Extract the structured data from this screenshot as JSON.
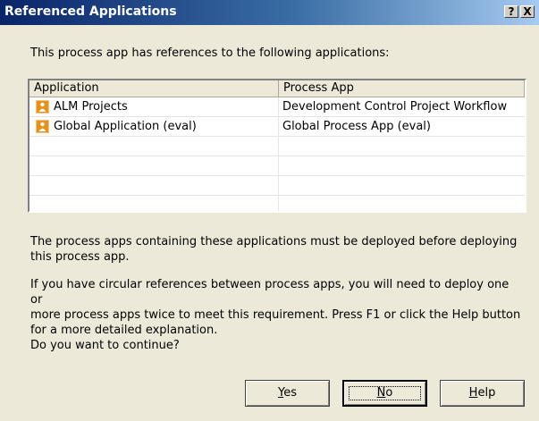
{
  "window": {
    "title": "Referenced Applications",
    "help_glyph": "?",
    "close_glyph": "X"
  },
  "intro": "This process app has references to the following applications:",
  "table": {
    "columns": [
      "Application",
      "Process App"
    ],
    "rows": [
      {
        "application": "ALM Projects",
        "process_app": "Development Control Project Workflow",
        "icon": "person-icon"
      },
      {
        "application": "Global Application (eval)",
        "process_app": "Global Process App (eval)",
        "icon": "person-icon"
      }
    ]
  },
  "paragraphs": {
    "p1_line1": "The process apps containing these applications must be deployed before deploying",
    "p1_line2": "this process app.",
    "p2_line1": "If you have circular references between process apps, you will need to deploy one or",
    "p2_line2": "more process apps twice to meet this requirement. Press F1 or click the Help button",
    "p2_line3": "for a more detailed explanation.",
    "question": "Do you want to continue?"
  },
  "buttons": {
    "yes": {
      "mnemonic": "Y",
      "rest": "es"
    },
    "no": {
      "mnemonic": "N",
      "rest": "o"
    },
    "help": {
      "mnemonic": "H",
      "rest": "elp"
    }
  },
  "colors": {
    "title_start": "#0a246a",
    "title_end": "#a6caf0",
    "icon_orange": "#e8901c"
  }
}
